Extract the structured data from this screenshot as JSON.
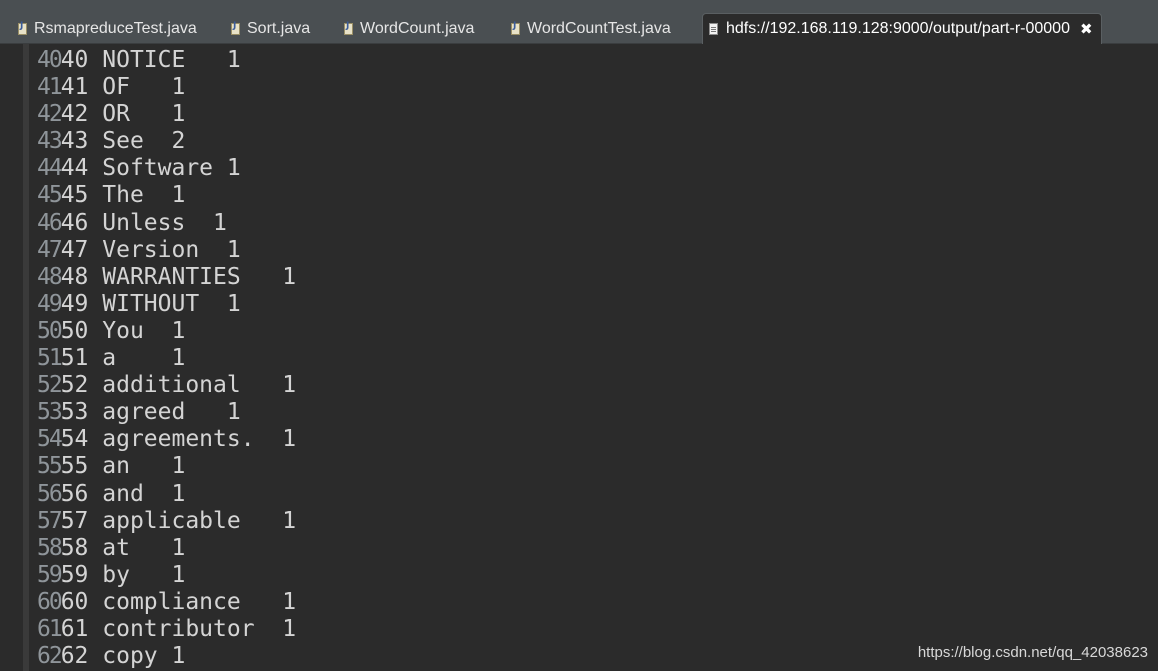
{
  "tabs": [
    {
      "label": "RsmapreduceTest.java",
      "icon": "java-file-icon"
    },
    {
      "label": "Sort.java",
      "icon": "java-file-icon"
    },
    {
      "label": "WordCount.java",
      "icon": "java-file-icon"
    },
    {
      "label": "WordCountTest.java",
      "icon": "java-file-icon"
    },
    {
      "label": "hdfs://192.168.119.128:9000/output/part-r-00000",
      "icon": "text-file-icon",
      "active": true,
      "close": "✖"
    }
  ],
  "lines": [
    {
      "num": "40",
      "text": "40 NOTICE   1"
    },
    {
      "num": "41",
      "text": "41 OF   1"
    },
    {
      "num": "42",
      "text": "42 OR   1"
    },
    {
      "num": "43",
      "text": "43 See  2"
    },
    {
      "num": "44",
      "text": "44 Software 1"
    },
    {
      "num": "45",
      "text": "45 The  1"
    },
    {
      "num": "46",
      "text": "46 Unless  1"
    },
    {
      "num": "47",
      "text": "47 Version  1"
    },
    {
      "num": "48",
      "text": "48 WARRANTIES   1"
    },
    {
      "num": "49",
      "text": "49 WITHOUT  1"
    },
    {
      "num": "50",
      "text": "50 You  1"
    },
    {
      "num": "51",
      "text": "51 a    1"
    },
    {
      "num": "52",
      "text": "52 additional   1"
    },
    {
      "num": "53",
      "text": "53 agreed   1"
    },
    {
      "num": "54",
      "text": "54 agreements.  1"
    },
    {
      "num": "55",
      "text": "55 an   1"
    },
    {
      "num": "56",
      "text": "56 and  1"
    },
    {
      "num": "57",
      "text": "57 applicable   1"
    },
    {
      "num": "58",
      "text": "58 at   1"
    },
    {
      "num": "59",
      "text": "59 by   1"
    },
    {
      "num": "60",
      "text": "60 compliance   1"
    },
    {
      "num": "61",
      "text": "61 contributor  1"
    },
    {
      "num": "62",
      "text": "62 copy 1"
    }
  ],
  "watermark": "https://blog.csdn.net/qq_42038623",
  "colors": {
    "background": "#2b2b2b",
    "tabbar": "#4a4f52",
    "text": "#d4d4d4",
    "line_number": "#8f959a"
  }
}
